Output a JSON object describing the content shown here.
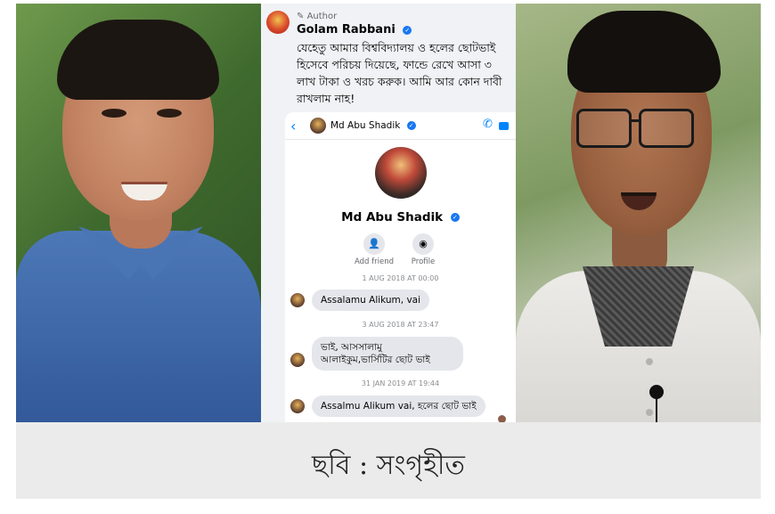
{
  "comment": {
    "author_tag": "Author",
    "author_name": "Golam Rabbani",
    "verified_mark": "✓",
    "text": "যেহেতু আমার বিশ্ববিদ্যালয় ও হলের ছোটভাই হিসেবে পরিচয় দিয়েছে, ফান্ডে রেখে আসা ৩ লাখ টাকা ও খরচ করুক। আমি আর কোন দাবী রাখলাম নাহ!"
  },
  "messenger": {
    "back_icon": "‹",
    "header_name": "Md Abu Shadik",
    "call_icon": "✆",
    "profile_name": "Md Abu Shadik",
    "actions": [
      {
        "label": "Add friend",
        "icon": "👤"
      },
      {
        "label": "Profile",
        "icon": "◉"
      }
    ],
    "messages": [
      {
        "date": "1 AUG 2018 AT 00:00",
        "text": "Assalamu Alikum, vai"
      },
      {
        "date": "3 AUG 2018 AT 23:47",
        "text": "ভাই, আসসালামু আলাইকুম,ভার্সিটির ছোট ভাই"
      },
      {
        "date": "31 JAN 2019 AT 19:44",
        "text": "Assalmu Alikum vai, হলের ছোট ভাই"
      }
    ]
  },
  "caption": {
    "text": "ছবি : সংগৃহীত"
  },
  "colors": {
    "messenger_blue": "#0084ff",
    "verified_blue": "#1877f2",
    "caption_bg": "#ebebeb"
  }
}
